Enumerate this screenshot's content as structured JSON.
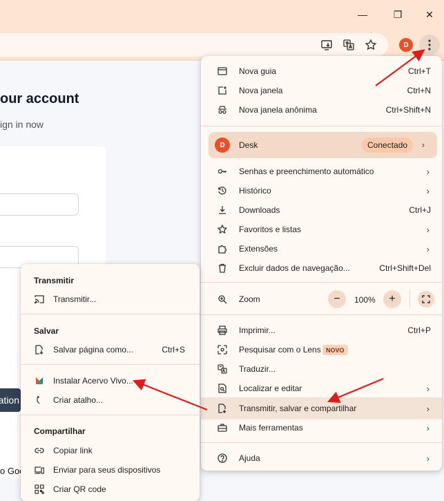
{
  "window": {
    "minimize": "—",
    "restore": "❐",
    "close": "✕"
  },
  "toolbar": {
    "install_icon": "install-app-icon",
    "translate_icon": "translate-icon",
    "bookmark_icon": "star-icon",
    "extension_badge": "desk-extension-icon",
    "menu_icon": "kebab-menu-icon"
  },
  "page": {
    "title": "our account",
    "subtitle": "ign in now",
    "button_text": "ation",
    "footer": "o Goo"
  },
  "main_menu": {
    "new_tab": {
      "label": "Nova guia",
      "shortcut": "Ctrl+T"
    },
    "new_window": {
      "label": "Nova janela",
      "shortcut": "Ctrl+N"
    },
    "incognito": {
      "label": "Nova janela anônima",
      "shortcut": "Ctrl+Shift+N"
    },
    "desk": {
      "label": "Desk",
      "status": "Conectado"
    },
    "passwords": {
      "label": "Senhas e preenchimento automático"
    },
    "history": {
      "label": "Histórico"
    },
    "downloads": {
      "label": "Downloads",
      "shortcut": "Ctrl+J"
    },
    "bookmarks": {
      "label": "Favoritos e listas"
    },
    "extensions": {
      "label": "Extensões"
    },
    "clear_data": {
      "label": "Excluir dados de navegação...",
      "shortcut": "Ctrl+Shift+Del"
    },
    "zoom": {
      "label": "Zoom",
      "minus": "−",
      "value": "100%",
      "plus": "+"
    },
    "print": {
      "label": "Imprimir...",
      "shortcut": "Ctrl+P"
    },
    "lens": {
      "label": "Pesquisar com o Lens",
      "badge": "NOVO"
    },
    "translate": {
      "label": "Traduzir..."
    },
    "find": {
      "label": "Localizar e editar"
    },
    "cast_save_share": {
      "label": "Transmitir, salvar e compartilhar"
    },
    "more_tools": {
      "label": "Mais ferramentas"
    },
    "help": {
      "label": "Ajuda"
    },
    "chevron": "›"
  },
  "sub_menu": {
    "cast_section": "Transmitir",
    "cast": {
      "label": "Transmitir..."
    },
    "save_section": "Salvar",
    "save_page": {
      "label": "Salvar página como...",
      "shortcut": "Ctrl+S"
    },
    "install_app": {
      "label": "Instalar Acervo Vivo..."
    },
    "create_shortcut": {
      "label": "Criar atalho..."
    },
    "share_section": "Compartilhar",
    "copy_link": {
      "label": "Copiar link"
    },
    "send_devices": {
      "label": "Enviar para seus dispositivos"
    },
    "qr_code": {
      "label": "Criar QR code"
    }
  },
  "colors": {
    "chrome_bg": "#fde4d3",
    "menu_bg": "#fff8f3",
    "accent": "#e8502b",
    "arrow": "#e01b1b"
  }
}
